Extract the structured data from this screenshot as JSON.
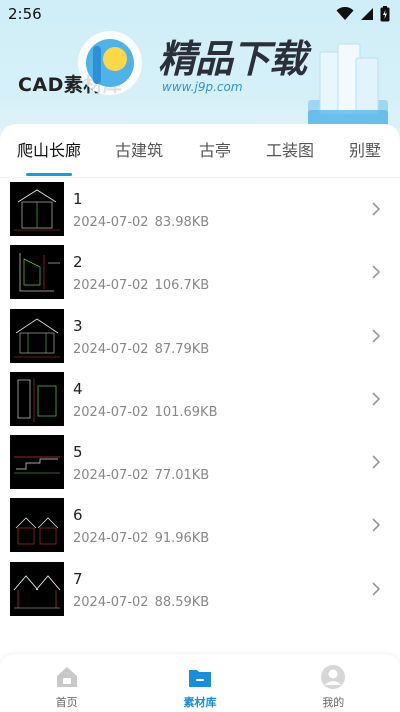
{
  "status_bar": {
    "time": "2:56"
  },
  "header": {
    "app_title": "CAD素材库",
    "brand_text": "精品下载",
    "brand_url": "www.j9p.com"
  },
  "tabs": [
    {
      "label": "爬山长廊",
      "active": true
    },
    {
      "label": "古建筑",
      "active": false
    },
    {
      "label": "古亭",
      "active": false
    },
    {
      "label": "工装图",
      "active": false
    },
    {
      "label": "别墅",
      "active": false
    }
  ],
  "files": [
    {
      "name": "1",
      "date": "2024-07-02",
      "size": "83.98KB"
    },
    {
      "name": "2",
      "date": "2024-07-02",
      "size": "106.7KB"
    },
    {
      "name": "3",
      "date": "2024-07-02",
      "size": "87.79KB"
    },
    {
      "name": "4",
      "date": "2024-07-02",
      "size": "101.69KB"
    },
    {
      "name": "5",
      "date": "2024-07-02",
      "size": "77.01KB"
    },
    {
      "name": "6",
      "date": "2024-07-02",
      "size": "91.96KB"
    },
    {
      "name": "7",
      "date": "2024-07-02",
      "size": "88.59KB"
    }
  ],
  "bottom_nav": [
    {
      "label": "首页",
      "icon": "home-icon",
      "active": false
    },
    {
      "label": "素材库",
      "icon": "folder-icon",
      "active": true
    },
    {
      "label": "我的",
      "icon": "user-icon",
      "active": false
    }
  ],
  "colors": {
    "accent": "#1a9be0",
    "header_bg": "#cfeef7"
  }
}
